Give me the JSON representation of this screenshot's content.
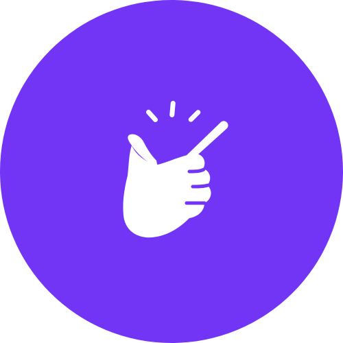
{
  "badge": {
    "background_color": "#7335F5",
    "icon_color": "#FFFFFF",
    "icon_name": "finger-snap-icon"
  }
}
